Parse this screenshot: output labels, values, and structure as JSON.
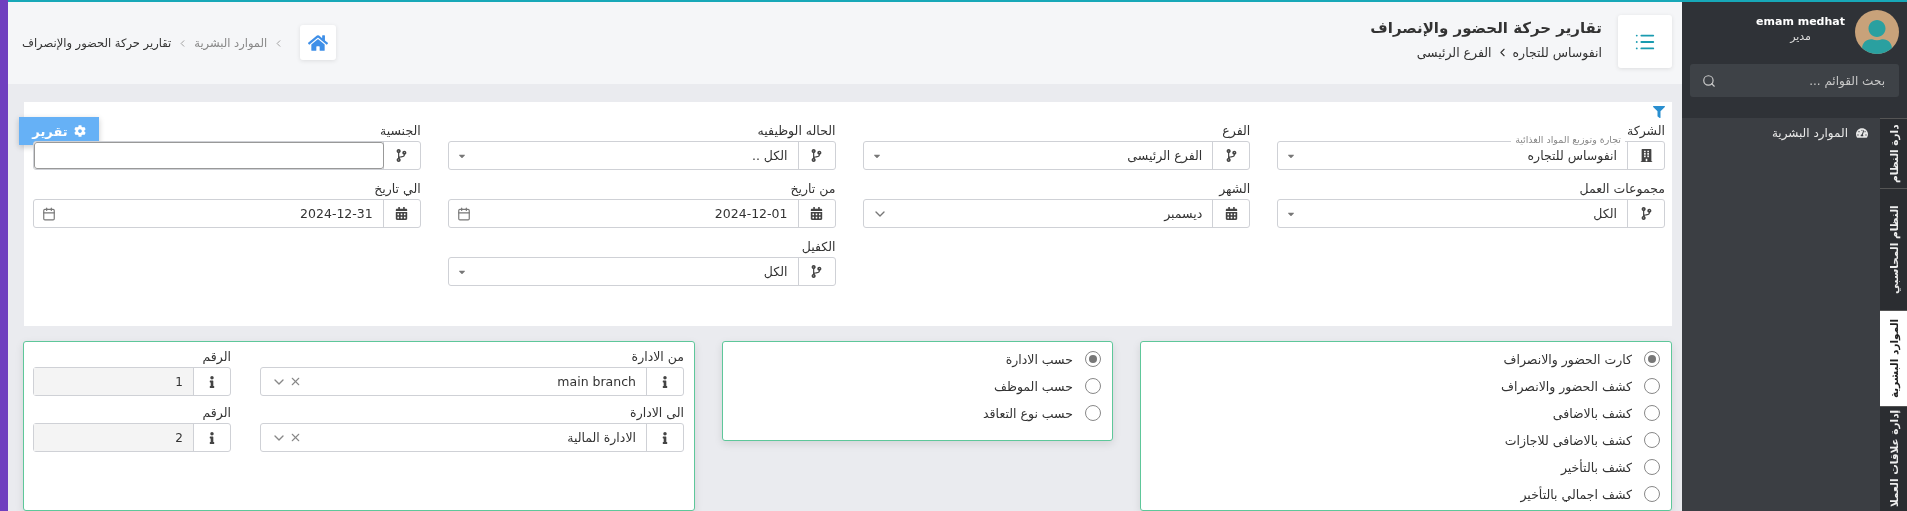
{
  "header": {
    "title": "تقارير حركة الحضور والإنصراف",
    "company": "انفوساس للتجاره",
    "branch": "الفرع الرئيسى",
    "breadcrumbs": [
      "الموارد البشرية",
      "تقارير حركة الحضور والإنصراف"
    ]
  },
  "filters": {
    "button": "تقرير",
    "rows": [
      [
        {
          "kind": "company",
          "label": "الشركة",
          "legend": "تجارة وتوزيع المواد الغذائية",
          "value": "انفوساس للتجاره"
        },
        {
          "kind": "select",
          "label": "الفرع",
          "value": "الفرع الرئيسى"
        },
        {
          "kind": "select",
          "label": "الحاله الوظيفيه",
          "value": "الكل .."
        },
        {
          "kind": "text",
          "label": "الجنسية"
        }
      ],
      [
        {
          "kind": "select",
          "label": "مجموعات العمل",
          "value": "الكل"
        },
        {
          "kind": "month",
          "label": "الشهر",
          "value": "ديسمبر"
        },
        {
          "kind": "date",
          "label": "من تاريخ",
          "value": "2024-12-01"
        },
        {
          "kind": "date",
          "label": "الي تاريخ",
          "value": "2024-12-31"
        }
      ],
      [
        null,
        null,
        {
          "kind": "select",
          "label": "الكفيل",
          "value": "الكل"
        },
        null
      ]
    ]
  },
  "report_types": [
    {
      "label": "كارت الحضور والانصراف",
      "selected": true
    },
    {
      "label": "كشف الحضور والانصراف",
      "selected": false
    },
    {
      "label": "كشف بالاضافى",
      "selected": false
    },
    {
      "label": "كشف بالاضافى للاجازات",
      "selected": false
    },
    {
      "label": "كشف بالتأخير",
      "selected": false
    },
    {
      "label": "كشف اجمالي بالتأخير",
      "selected": false
    }
  ],
  "grouping": [
    {
      "label": "حسب الادارة",
      "selected": true
    },
    {
      "label": "حسب الموظف",
      "selected": false
    },
    {
      "label": "حسب نوع التعاقد",
      "selected": false
    }
  ],
  "departments": [
    {
      "label": "من الادارة",
      "value": "main branch",
      "number_label": "الرقم",
      "number": "1"
    },
    {
      "label": "الى الادارة",
      "value": "الادارة المالية",
      "number_label": "الرقم",
      "number": "2"
    }
  ],
  "sidebar": {
    "user": {
      "name": "emam medhat",
      "role": "مدير"
    },
    "search": {
      "placeholder": "بحث القوائم ..."
    },
    "items": [
      {
        "label": "الموارد البشرية"
      }
    ],
    "tabs": [
      {
        "label": "دارة النظام",
        "selected": false
      },
      {
        "label": "النظام المحاسبي",
        "selected": false
      },
      {
        "label": "الموارد البشرية",
        "selected": true
      },
      {
        "label": "إدارة علاقات العملا",
        "selected": false
      }
    ]
  }
}
